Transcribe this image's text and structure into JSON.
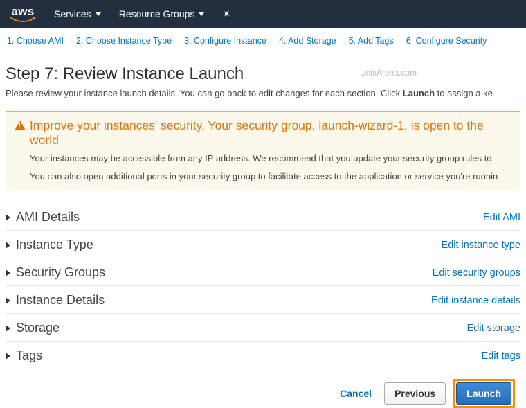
{
  "nav": {
    "logo": "aws",
    "services": "Services",
    "resource_groups": "Resource Groups"
  },
  "steps": [
    "1. Choose AMI",
    "2. Choose Instance Type",
    "3. Configure Instance",
    "4. Add Storage",
    "5. Add Tags",
    "6. Configure Security"
  ],
  "watermark": "UnixArena.com",
  "header": {
    "title": "Step 7: Review Instance Launch",
    "subtitle_pre": "Please review your instance launch details. You can go back to edit changes for each section. Click ",
    "subtitle_bold": "Launch",
    "subtitle_post": " to assign a ke"
  },
  "warning": {
    "title": "Improve your instances' security. Your security group, launch-wizard-1, is open to the world",
    "line1": "Your instances may be accessible from any IP address. We recommend that you update your security group rules to",
    "line2": "You can also open additional ports in your security group to facilitate access to the application or service you're runnin"
  },
  "sections": [
    {
      "title": "AMI Details",
      "edit": "Edit AMI"
    },
    {
      "title": "Instance Type",
      "edit": "Edit instance type"
    },
    {
      "title": "Security Groups",
      "edit": "Edit security groups"
    },
    {
      "title": "Instance Details",
      "edit": "Edit instance details"
    },
    {
      "title": "Storage",
      "edit": "Edit storage"
    },
    {
      "title": "Tags",
      "edit": "Edit tags"
    }
  ],
  "footer": {
    "cancel": "Cancel",
    "previous": "Previous",
    "launch": "Launch"
  }
}
